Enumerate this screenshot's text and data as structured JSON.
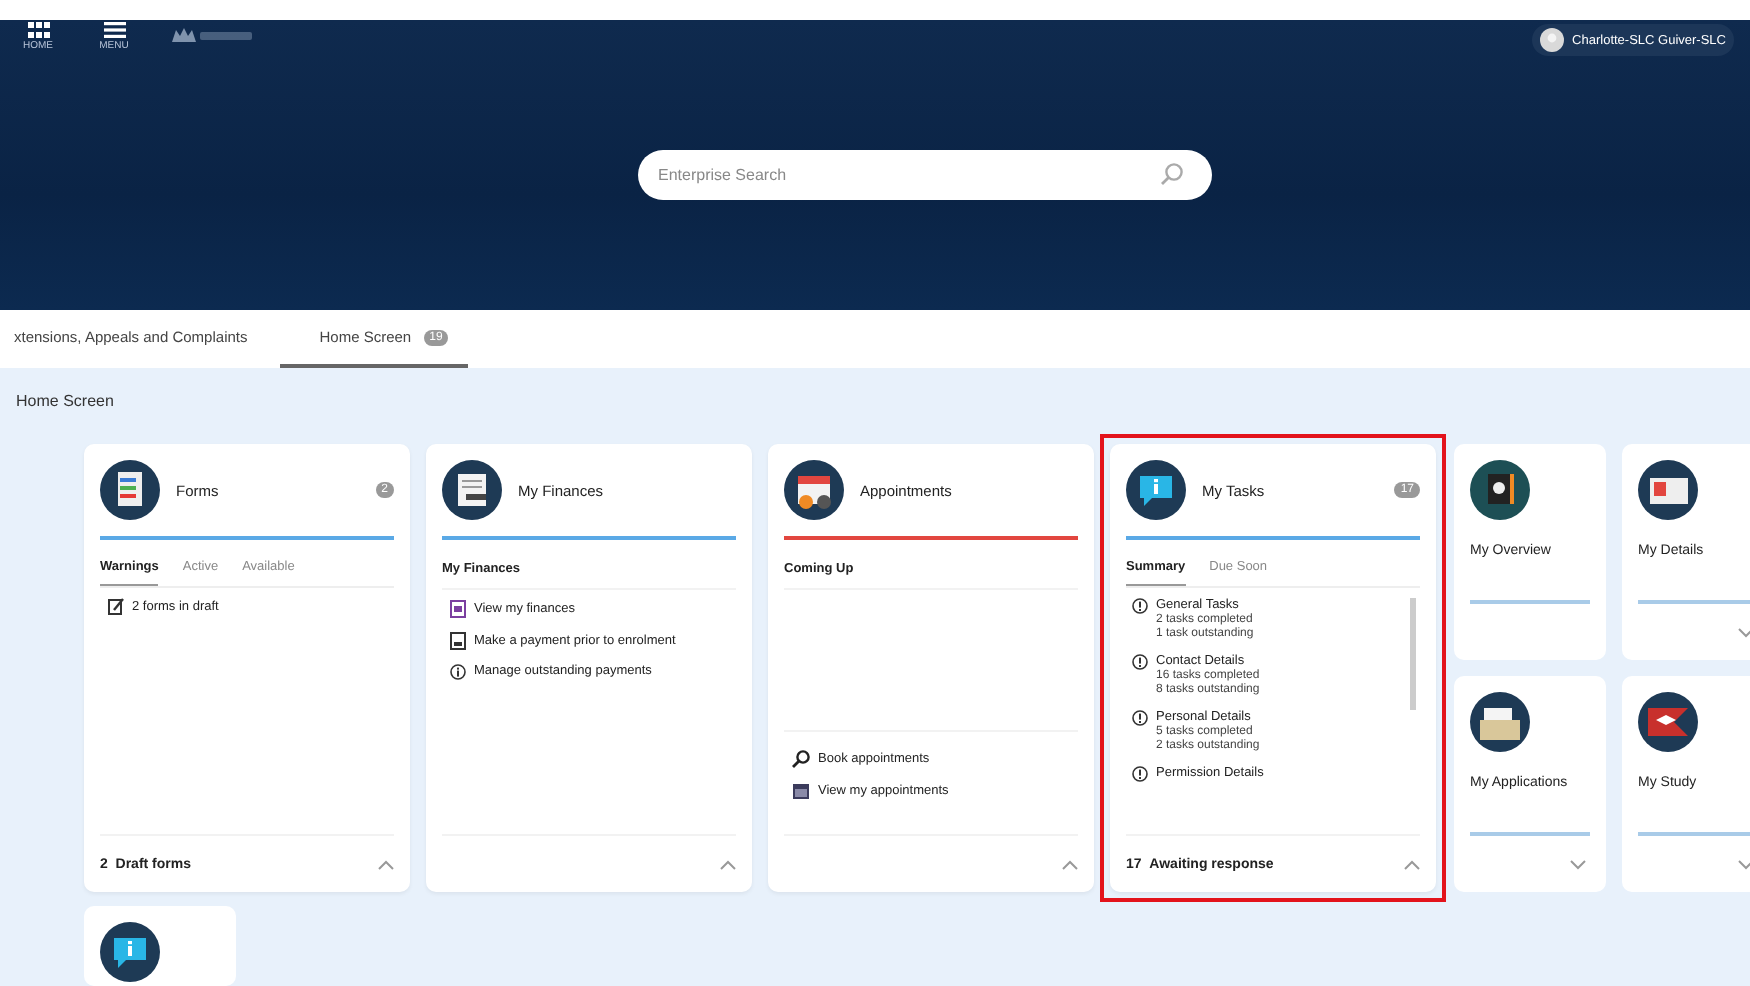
{
  "header": {
    "home_label": "HOME",
    "menu_label": "MENU",
    "user_name": "Charlotte-SLC Guiver-SLC"
  },
  "search": {
    "placeholder": "Enterprise Search"
  },
  "tabs": [
    {
      "label": "xtensions, Appeals and Complaints",
      "selected": false
    },
    {
      "label": "Home Screen",
      "badge": "19",
      "selected": true
    }
  ],
  "breadcrumb": "Home Screen",
  "cards": [
    {
      "kind": "forms",
      "title": "Forms",
      "badge": "2",
      "color": "#5aa9e6",
      "expanded": true,
      "subtabs": [
        {
          "label": "Warnings",
          "selected": true
        },
        {
          "label": "Active",
          "selected": false
        },
        {
          "label": "Available",
          "selected": false
        }
      ],
      "links": [
        {
          "kind": "edit",
          "text": "2 forms in draft"
        }
      ],
      "footer_count": "2",
      "footer_text": "Draft forms"
    },
    {
      "kind": "finances",
      "title": "My Finances",
      "color": "#5aa9e6",
      "expanded": true,
      "section": "My Finances",
      "links": [
        {
          "kind": "document",
          "text": "View my finances"
        },
        {
          "kind": "receipt",
          "text": "Make a payment prior to enrolment"
        },
        {
          "kind": "info",
          "text": "Manage outstanding payments"
        }
      ]
    },
    {
      "kind": "calendar",
      "title": "Appointments",
      "color": "#e2463f",
      "expanded": true,
      "section": "Coming Up",
      "bottom_links": [
        {
          "kind": "search",
          "text": "Book appointments"
        },
        {
          "kind": "calendar",
          "text": "View my appointments"
        }
      ]
    },
    {
      "kind": "info",
      "title": "My Tasks",
      "badge": "17",
      "color": "#5aa9e6",
      "expanded": true,
      "highlighted": true,
      "subtabs": [
        {
          "label": "Summary",
          "selected": true
        },
        {
          "label": "Due Soon",
          "selected": false
        }
      ],
      "tasks": [
        {
          "title": "General Tasks",
          "lines": [
            "2 tasks completed",
            "1 task outstanding"
          ]
        },
        {
          "title": "Contact Details",
          "lines": [
            "16 tasks completed",
            "8 tasks outstanding"
          ]
        },
        {
          "title": "Personal Details",
          "lines": [
            "5 tasks completed",
            "2 tasks outstanding"
          ]
        },
        {
          "title": "Permission Details"
        }
      ],
      "footer_count": "17",
      "footer_text": "Awaiting response"
    }
  ],
  "tiles": [
    {
      "kind": "overview",
      "title": "My Overview"
    },
    {
      "kind": "details",
      "title": "My Details",
      "expanded": false
    },
    {
      "kind": "applications",
      "title": "My Applications",
      "expanded": false
    },
    {
      "kind": "study",
      "title": "My Study",
      "expanded": false
    }
  ],
  "bottom_tile": {
    "kind": "info"
  }
}
